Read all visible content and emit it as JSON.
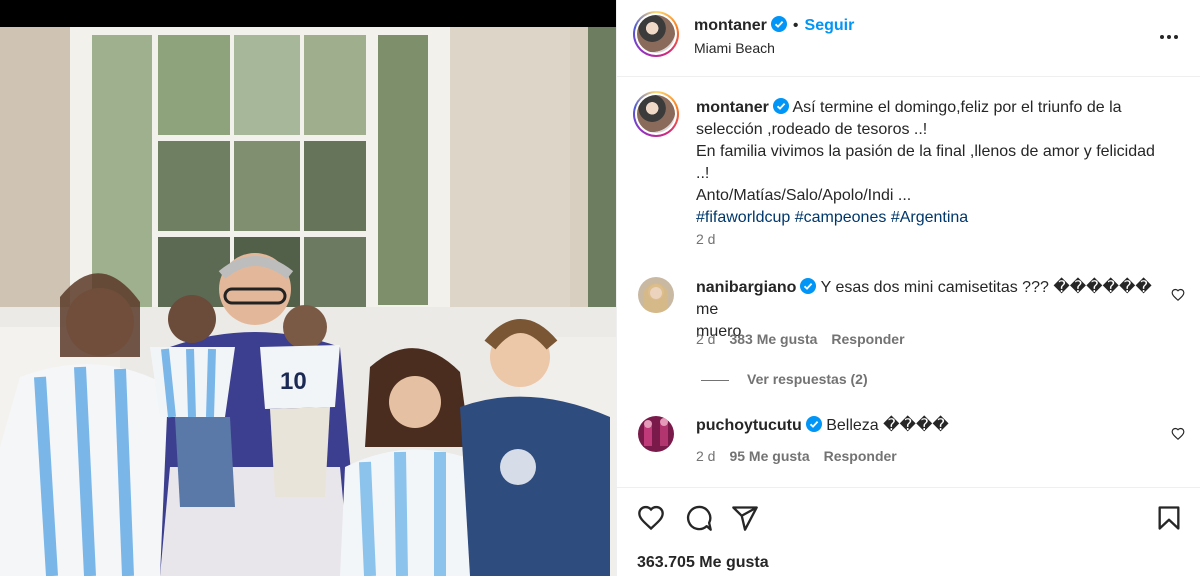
{
  "post": {
    "username": "montaner",
    "follow_label": "Seguir",
    "dot": "•",
    "location": "Miami Beach",
    "more_icon": "more-horizontal-icon"
  },
  "caption": {
    "username": "montaner",
    "line1": "Así termine el domingo,feliz por el triunfo de la",
    "line2": "selección ,rodeado de tesoros ..!",
    "line3": "En familia vivimos la pasión de la final ,llenos de amor y felicidad",
    "line4": "..!",
    "line5": "Anto/Matías/Salo/Apolo/Indi ...",
    "hashtags": [
      "#fifaworldcup",
      "#campeones",
      "#Argentina"
    ],
    "time": "2 d"
  },
  "comments": [
    {
      "username": "nanibargiano",
      "text_line1": "Y esas dos mini camisetitas ??? ������ me",
      "text_line2": "muero",
      "time": "2 d",
      "likes": "383 Me gusta",
      "reply": "Responder"
    },
    {
      "username": "puchoytucutu",
      "text_line1": "Belleza ����",
      "time": "2 d",
      "likes": "95 Me gusta",
      "reply": "Responder"
    }
  ],
  "view_replies": "Ver respuestas (2)",
  "likes_count": "363.705 Me gusta",
  "colors": {
    "accent": "#0095f6",
    "hashtag": "#00376b",
    "muted": "#737373",
    "verified": "#0095f6"
  }
}
